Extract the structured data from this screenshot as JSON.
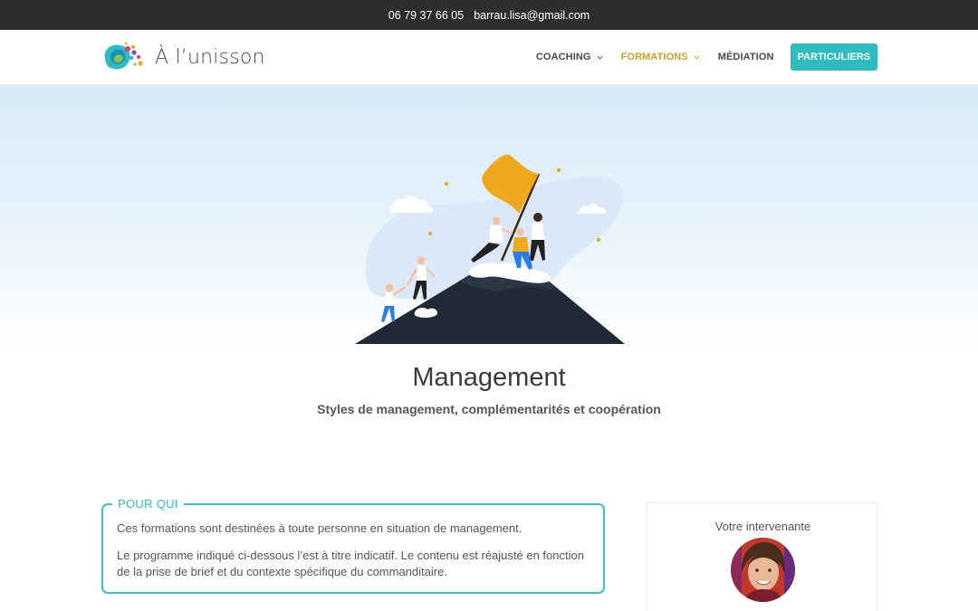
{
  "topbar": {
    "phone": "06 79 37 66 05",
    "email": "barrau.lisa@gmail.com"
  },
  "header": {
    "logo_text": "À l’unisson",
    "nav": [
      {
        "label": "COACHING",
        "has_dropdown": true,
        "active": false
      },
      {
        "label": "FORMATIONS",
        "has_dropdown": true,
        "active": true
      },
      {
        "label": "MÉDIATION",
        "has_dropdown": false,
        "active": false
      }
    ],
    "cta_label": "PARTICULIERS"
  },
  "hero": {
    "title": "Management",
    "subtitle": "Styles de management, complémentarités et coopération"
  },
  "pour_qui": {
    "legend": "POUR QUI",
    "p1": "Ces formations sont destinées à toute personne en situation de management.",
    "p2": "Le programme indiqué ci-dessous l’est à titre indicatif. Le contenu est réajusté en fonction de la prise de brief et du contexte spécifique du commanditaire."
  },
  "sidebar": {
    "title": "Votre intervenante"
  },
  "colors": {
    "accent": "#2ebcbe",
    "active_nav": "#c9a227",
    "topbar": "#2e2e2e",
    "flag": "#f0a81c"
  },
  "icons": {
    "nav_dropdown": "chevron-down-icon"
  }
}
